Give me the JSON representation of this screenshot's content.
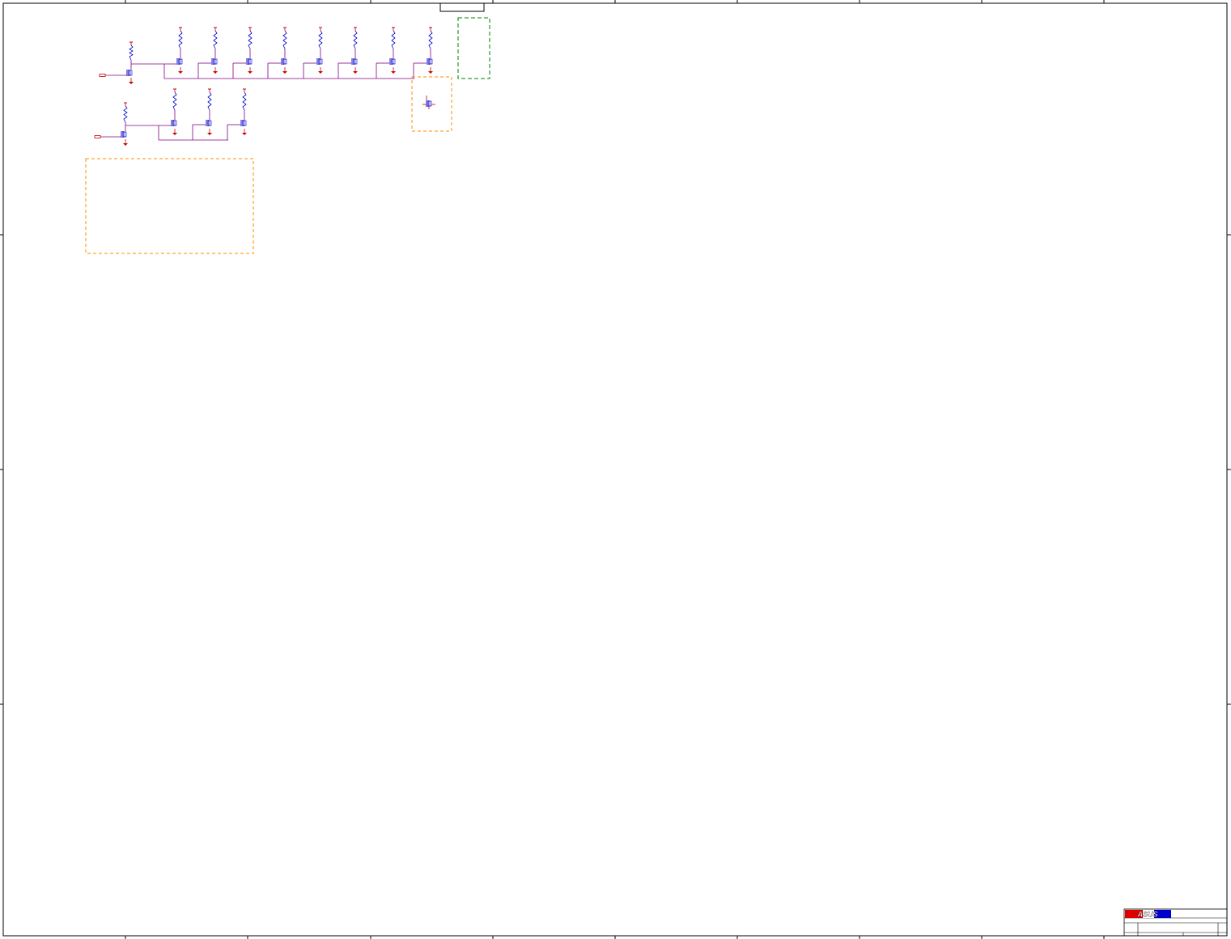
{
  "sheet": {
    "logo_text": "ASUS",
    "colors": {
      "border": "#000000",
      "wire": "#800080",
      "power": "#cc0000",
      "component": "#0000cc",
      "highlight_box": "#ff8c00",
      "note_box": "#008000",
      "logo_red": "#dd0000",
      "logo_blue": "#0000cc"
    }
  },
  "schematic": {
    "top_row_transistor_count": 8,
    "bottom_row_transistor_count": 3
  }
}
